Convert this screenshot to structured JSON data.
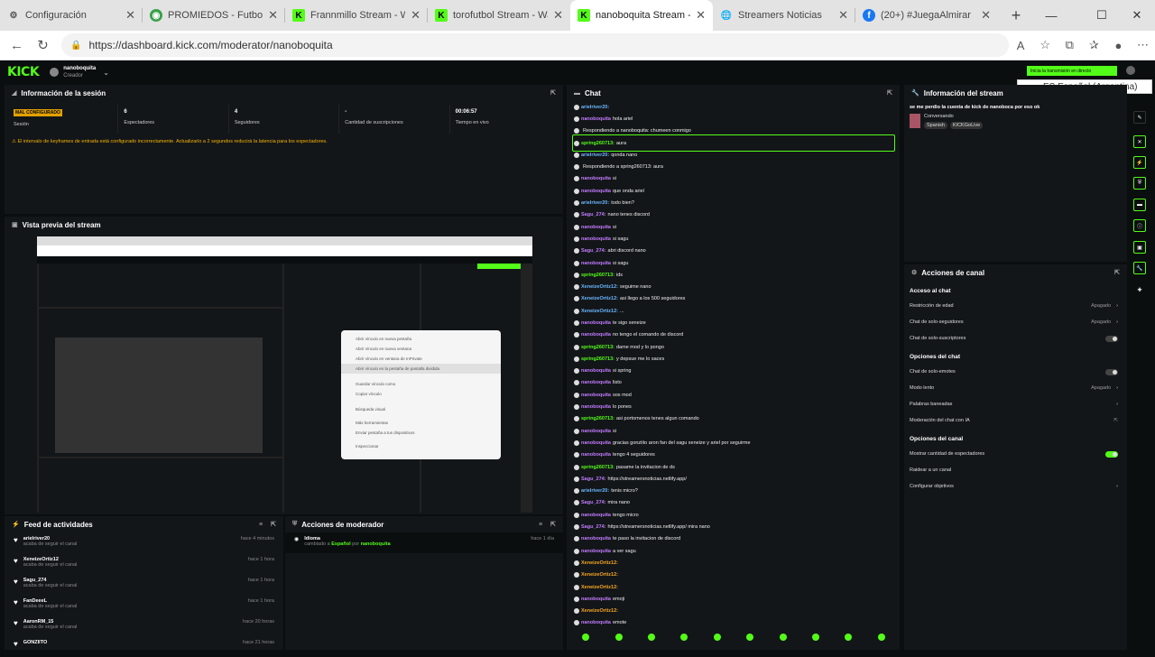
{
  "browser": {
    "tabs": [
      {
        "label": "Configuración",
        "icon": "gear"
      },
      {
        "label": "PROMIEDOS - Futbol Ar",
        "icon": "promiedos"
      },
      {
        "label": "Frannmillo Stream - Wat",
        "icon": "kick"
      },
      {
        "label": "torofutbol Stream - Watc",
        "icon": "kick"
      },
      {
        "label": "nanoboquita Stream - Ki",
        "icon": "kick",
        "active": true
      },
      {
        "label": "Streamers Noticias",
        "icon": "globe"
      },
      {
        "label": "(20+) #JuegaAlmirar",
        "icon": "facebook"
      }
    ],
    "new_tab": "+",
    "url": "https://dashboard.kick.com/moderator/nanoboquita"
  },
  "kick": {
    "logo": "KICK",
    "username": "nanoboquita",
    "role": "Creador",
    "go_live": "Inicia la transmisión en directo",
    "lang_popup": "ES Español (Argentina)"
  },
  "session": {
    "title": "Información de la sesión",
    "stats": [
      {
        "value": "MAL CONFIGURADO",
        "label": "Sesión"
      },
      {
        "value": "6",
        "label": "Espectadores"
      },
      {
        "value": "4",
        "label": "Seguidores"
      },
      {
        "value": "-",
        "label": "Cantidad de suscripciones"
      },
      {
        "value": "00:06:57",
        "label": "Tiempo en vivo"
      }
    ],
    "warning": "El intervalo de keyframes de entrada está configurado incorrectamente. Actualizarlo a 2 segundos reducirá la latencia para los espectadores."
  },
  "preview": {
    "title": "Vista previa del stream",
    "context_menu": [
      "Abrir vínculo en nueva pestaña",
      "Abrir vínculo en nueva ventana",
      "Abrir vínculo en ventana de InPrivate",
      "Abrir vínculo en la pestaña de pantalla dividida",
      "Guardar vínculo como",
      "Copiar vínculo",
      "Búsqueda visual",
      "Más herramientas",
      "Enviar pestaña a tus dispositivos",
      "Inspeccionar"
    ]
  },
  "feed": {
    "title": "Feed de actividades",
    "items": [
      {
        "user": "arielriver20",
        "sub": "acaba de seguir el canal",
        "time": "hace 4 minutos"
      },
      {
        "user": "XeneizeOrtiz12",
        "sub": "acaba de seguir el canal",
        "time": "hace 1 hora"
      },
      {
        "user": "Sagu_274",
        "sub": "acaba de seguir el canal",
        "time": "hace 1 hora"
      },
      {
        "user": "FanDeeeL",
        "sub": "acaba de seguir el canal",
        "time": "hace 1 hora"
      },
      {
        "user": "AaronRM_15",
        "sub": "acaba de seguir el canal",
        "time": "hace 20 horas"
      },
      {
        "user": "GONZIITO",
        "sub": "",
        "time": "hace 21 horas"
      }
    ]
  },
  "modactions": {
    "title": "Acciones de moderador",
    "item": {
      "title": "Idioma",
      "text": "cambiado a",
      "lang": "Español",
      "by": "por",
      "user": "nanoboquita",
      "time": "hace 1 día"
    }
  },
  "chat": {
    "title": "Chat",
    "messages": [
      {
        "user": "arielriver20:",
        "text": "",
        "color": "#6ab7ff"
      },
      {
        "user": "nanoboquita",
        "text": "hola ariel",
        "color": "#c27bff"
      },
      {
        "user": "",
        "text": "Respondiendo a nanoboquita: chumeen conmigo",
        "color": "#888"
      },
      {
        "user": "spring260713:",
        "text": "aura",
        "color": "#53fc18"
      },
      {
        "user": "arielriver20:",
        "text": "qonda nano",
        "color": "#6ab7ff"
      },
      {
        "user": "",
        "text": "Respondiendo a spring260713: aura",
        "color": "#888"
      },
      {
        "user": "nanoboquita",
        "text": "si",
        "color": "#c27bff"
      },
      {
        "user": "nanoboquita",
        "text": "que onda ariel",
        "color": "#c27bff"
      },
      {
        "user": "arielriver20:",
        "text": "todo bien?",
        "color": "#6ab7ff"
      },
      {
        "user": "Sagu_274:",
        "text": "nano tenes discord",
        "color": "#c27bff"
      },
      {
        "user": "nanoboquita",
        "text": "si",
        "color": "#c27bff"
      },
      {
        "user": "nanoboquita",
        "text": "si sagu",
        "color": "#c27bff"
      },
      {
        "user": "Sagu_274:",
        "text": "abri discord nano",
        "color": "#c27bff"
      },
      {
        "user": "nanoboquita",
        "text": "si sagu",
        "color": "#c27bff"
      },
      {
        "user": "spring260713:",
        "text": "ids",
        "color": "#53fc18"
      },
      {
        "user": "XeneizeOrtiz12:",
        "text": "seguime nano",
        "color": "#6ab7ff"
      },
      {
        "user": "XeneizeOrtiz12:",
        "text": "asi llego a los 500 seguidores",
        "color": "#6ab7ff"
      },
      {
        "user": "XeneizeOrtiz12:",
        "text": "...",
        "color": "#6ab7ff"
      },
      {
        "user": "nanoboquita",
        "text": "te sigo xeneize",
        "color": "#c27bff"
      },
      {
        "user": "nanoboquita",
        "text": "no tengo el comando de discord",
        "color": "#c27bff"
      },
      {
        "user": "spring260713:",
        "text": "dame mod y lo pongo",
        "color": "#53fc18"
      },
      {
        "user": "spring260713:",
        "text": "y depsue me lo saces",
        "color": "#53fc18"
      },
      {
        "user": "nanoboquita",
        "text": "si spring",
        "color": "#c27bff"
      },
      {
        "user": "nanoboquita",
        "text": "listo",
        "color": "#c27bff"
      },
      {
        "user": "nanoboquita",
        "text": "sos mod",
        "color": "#c27bff"
      },
      {
        "user": "nanoboquita",
        "text": "lo pones",
        "color": "#c27bff"
      },
      {
        "user": "spring260713:",
        "text": "asi portomenos tenes algun comando",
        "color": "#53fc18"
      },
      {
        "user": "nanoboquita",
        "text": "si",
        "color": "#c27bff"
      },
      {
        "user": "nanoboquita",
        "text": "gracias gonziito aron fan del sagu xeneize y ariel por seguirme",
        "color": "#c27bff"
      },
      {
        "user": "nanoboquita",
        "text": "tengo 4 seguidores",
        "color": "#c27bff"
      },
      {
        "user": "spring260713:",
        "text": "pasame la invitacion de ds",
        "color": "#53fc18"
      },
      {
        "user": "Sagu_274:",
        "text": "https://streamersnoticias.netlify.app/",
        "color": "#c27bff"
      },
      {
        "user": "arielriver20:",
        "text": "tenis micro?",
        "color": "#6ab7ff"
      },
      {
        "user": "Sagu_274:",
        "text": "mira nano",
        "color": "#c27bff"
      },
      {
        "user": "nanoboquita",
        "text": "tengo micro",
        "color": "#c27bff"
      },
      {
        "user": "Sagu_274:",
        "text": "https://streamersnoticias.netlify.app/ mira nano",
        "color": "#c27bff"
      },
      {
        "user": "nanoboquita",
        "text": "te paso la invitacion de discord",
        "color": "#c27bff"
      },
      {
        "user": "nanoboquita",
        "text": "a ver sagu",
        "color": "#c27bff"
      },
      {
        "user": "XeneizeOrtiz12:",
        "text": "",
        "color": "#f5a623"
      },
      {
        "user": "XeneizeOrtiz12:",
        "text": "",
        "color": "#f5a623"
      },
      {
        "user": "XeneizeOrtiz12:",
        "text": "",
        "color": "#f5a623"
      },
      {
        "user": "nanoboquita",
        "text": "emoji",
        "color": "#c27bff"
      },
      {
        "user": "XeneizeOrtiz12:",
        "text": "",
        "color": "#f5a623"
      },
      {
        "user": "nanoboquita",
        "text": "emote",
        "color": "#c27bff"
      }
    ]
  },
  "streaminfo": {
    "title": "Información del stream",
    "stream_title": "se me perdio la cuenta de kick de nanoboca por eso ok",
    "category": "Conversando",
    "tags": [
      "Spanish",
      "KICKGoLive"
    ]
  },
  "channel": {
    "title": "Acciones de canal",
    "sections": [
      {
        "heading": "Acceso al chat",
        "options": [
          {
            "label": "Restricción de edad",
            "value": "Apagado",
            "type": "arrow"
          },
          {
            "label": "Chat de solo-seguidores",
            "value": "Apagado",
            "type": "arrow"
          },
          {
            "label": "Chat de solo-suscriptores",
            "value": "",
            "type": "toggle-off"
          }
        ]
      },
      {
        "heading": "Opciones del chat",
        "options": [
          {
            "label": "Chat de solo-emotes",
            "value": "",
            "type": "toggle-off"
          },
          {
            "label": "Modo lento",
            "value": "Apagado",
            "type": "arrow"
          },
          {
            "label": "Palabras baneadas",
            "value": "",
            "type": "arrow"
          },
          {
            "label": "Moderación del chat con IA",
            "value": "",
            "type": "link"
          }
        ]
      },
      {
        "heading": "Opciones del canal",
        "options": [
          {
            "label": "Mostrar cantidad de espectadores",
            "value": "",
            "type": "toggle-on"
          },
          {
            "label": "Raidear a un canal",
            "value": "",
            "type": "none"
          },
          {
            "label": "Configurar objetivos",
            "value": "",
            "type": "arrow"
          }
        ]
      }
    ]
  },
  "colors": {
    "accent": "#53fc18",
    "bg": "#0b0e0f",
    "panel": "#131619"
  }
}
